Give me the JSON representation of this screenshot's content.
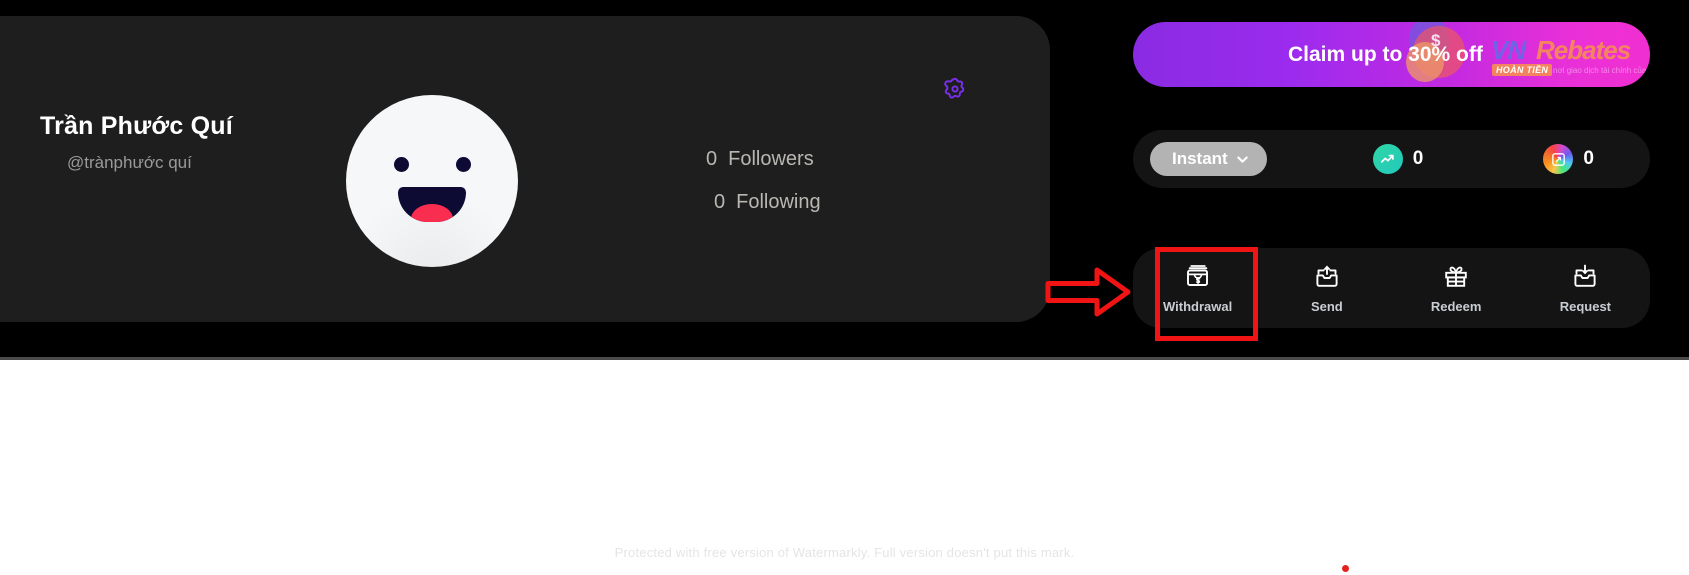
{
  "profile": {
    "name": "Trần Phước Quí",
    "handle": "@trànphước quí",
    "avatar_icon": "smiley-face-avatar",
    "settings_icon": "gear-icon",
    "stats": [
      {
        "value": "0",
        "label": "Followers"
      },
      {
        "value": "0",
        "label": "Following"
      }
    ]
  },
  "promo": {
    "text": "Claim up to 30% off",
    "brand_vn": "VN",
    "brand_rebates": "Rebates",
    "brand_badge": "HOÀN TIỀN",
    "brand_tagline": "nơi giao dịch tài chính của bạn",
    "gradient_start": "#8a2be2",
    "gradient_end": "#f12fd1"
  },
  "balance": {
    "mode_label": "Instant",
    "mode_chevron_icon": "chevron-down-icon",
    "items": [
      {
        "icon": "trending-up-icon",
        "value": "0",
        "color": "#2fd6a5"
      },
      {
        "icon": "nft-badge-icon",
        "value": "0",
        "color": "#d14ad1"
      }
    ]
  },
  "actions": [
    {
      "label": "Withdrawal",
      "icon": "cash-withdrawal-icon",
      "highlighted": true
    },
    {
      "label": "Send",
      "icon": "send-upload-icon",
      "highlighted": false
    },
    {
      "label": "Redeem",
      "icon": "gift-box-icon",
      "highlighted": false
    },
    {
      "label": "Request",
      "icon": "download-inbox-icon",
      "highlighted": false
    }
  ],
  "annotations": {
    "highlight_color": "#f01414",
    "arrow_icon": "right-arrow-annotation",
    "dot_color": "#e61f1f"
  },
  "watermark": {
    "text": "Protected with free version of Watermarkly. Full version doesn't put this mark."
  }
}
